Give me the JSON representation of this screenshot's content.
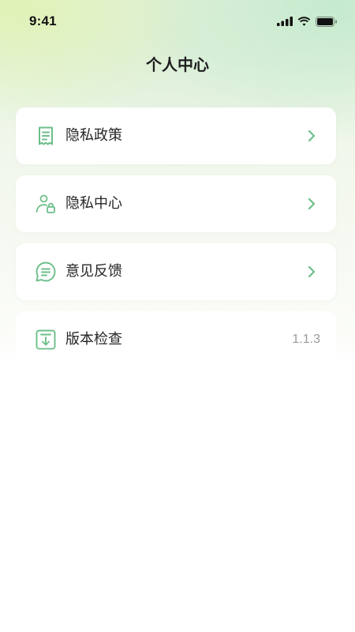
{
  "status_bar": {
    "time": "9:41",
    "icons": [
      "cellular-signal-icon",
      "wifi-icon",
      "battery-icon"
    ]
  },
  "header": {
    "title": "个人中心"
  },
  "menu": {
    "items": [
      {
        "label": "隐私政策",
        "icon": "receipt-document-icon"
      },
      {
        "label": "隐私中心",
        "icon": "user-lock-icon"
      },
      {
        "label": "意见反馈",
        "icon": "chat-bubble-icon"
      },
      {
        "label": "版本检查",
        "icon": "download-box-icon",
        "value": "1.1.3"
      }
    ]
  },
  "colors": {
    "accent": "#6cbf8a",
    "text_primary": "#262626",
    "text_secondary": "#9a9a9a"
  }
}
